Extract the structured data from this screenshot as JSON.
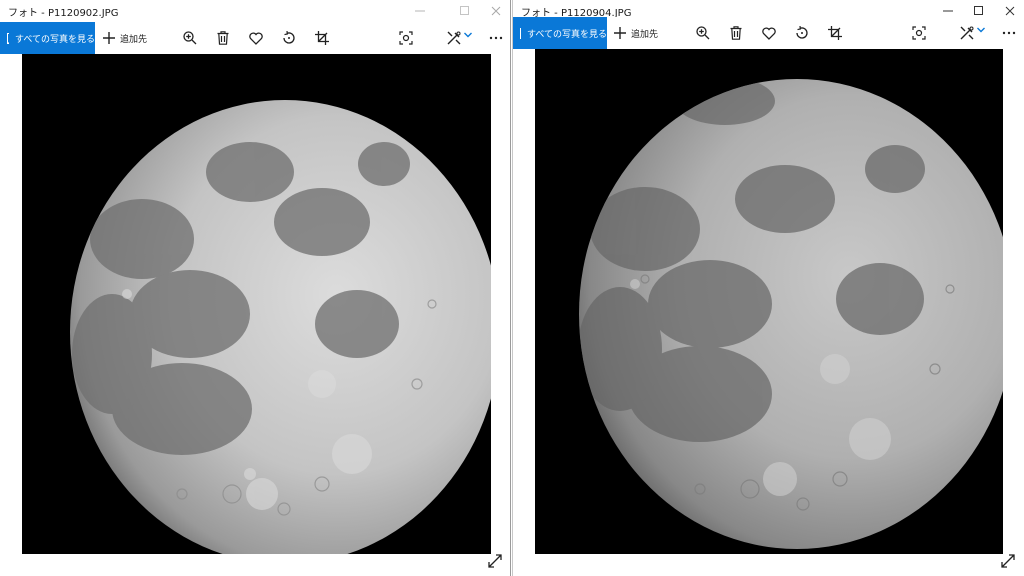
{
  "left_window": {
    "title": "フォト - P1120902.JPG",
    "toolbar": {
      "all_photos_label": "すべての写真を見る",
      "add_to_label": "追加先",
      "icons": [
        "photos-icon",
        "plus-icon",
        "zoom-in-icon",
        "trash-icon",
        "heart-icon",
        "rotate-icon",
        "crop-icon",
        "slideshow-icon",
        "edit-icon",
        "chevron-down-icon",
        "more-icon"
      ]
    },
    "window_controls": [
      "minimize-icon",
      "maximize-icon",
      "close-icon"
    ]
  },
  "right_window": {
    "title": "フォト - P1120904.JPG",
    "toolbar": {
      "all_photos_label": "すべての写真を見る",
      "add_to_label": "追加先",
      "icons": [
        "photos-icon",
        "plus-icon",
        "zoom-in-icon",
        "trash-icon",
        "heart-icon",
        "rotate-icon",
        "crop-icon",
        "slideshow-icon",
        "edit-icon",
        "chevron-down-icon",
        "more-icon"
      ]
    },
    "window_controls": [
      "minimize-icon",
      "maximize-icon",
      "close-icon"
    ]
  },
  "colors": {
    "accent": "#0a78d7",
    "toolbar_bg": "#ffffff",
    "photo_bg": "#000000"
  }
}
